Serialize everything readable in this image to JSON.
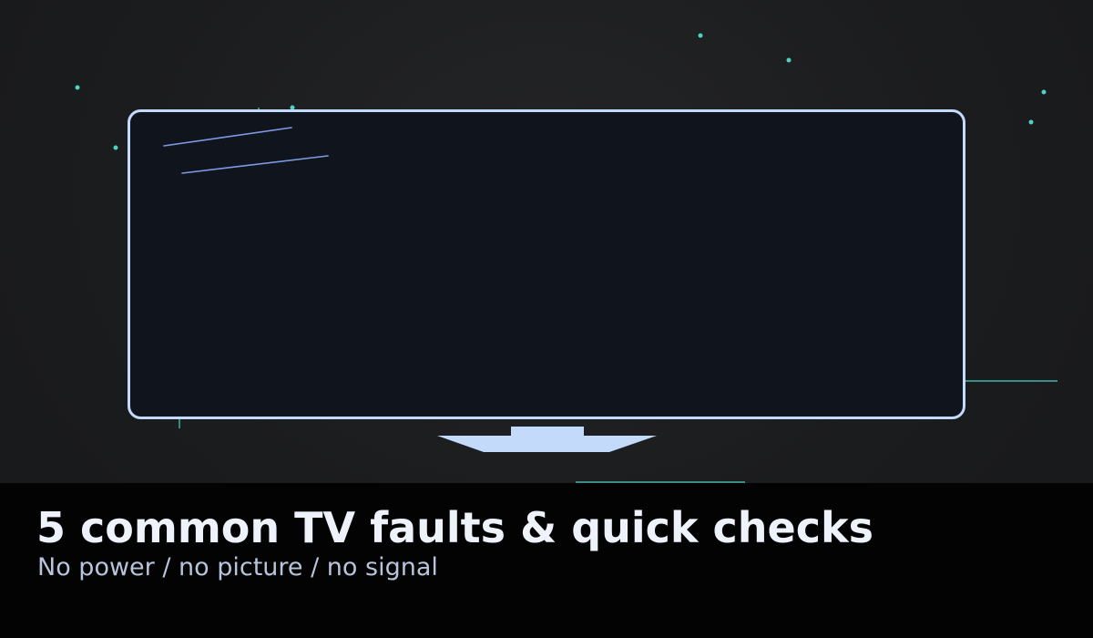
{
  "colors": {
    "screen_fill": "#10141d",
    "screen_outline": "#c4dafb",
    "stand": "#c4dafb",
    "glare": "#7f9ae6",
    "sparkle": "#4fd2c2",
    "caption_bar": "#030303",
    "title": "#eef2fb",
    "subtitle": "#b7c4dc"
  },
  "caption": {
    "title": "5 common TV faults & quick checks",
    "subtitle": "No power / no picture / no signal"
  }
}
